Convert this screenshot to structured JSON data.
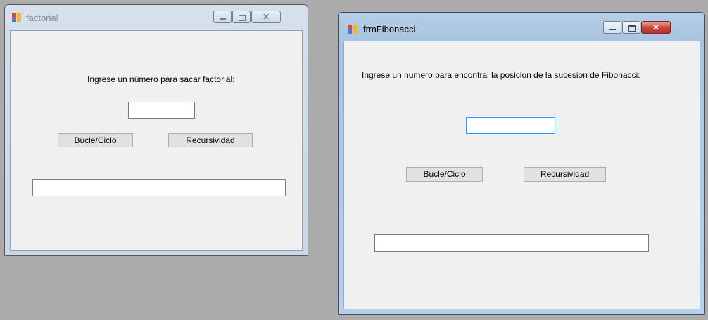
{
  "factorial_window": {
    "title": "factorial",
    "prompt_label": "Ingrese un número para sacar factorial:",
    "input_value": "",
    "loop_button": "Bucle/Ciclo",
    "recursion_button": "Recursividad",
    "result_value": ""
  },
  "fibonacci_window": {
    "title": "frmFibonacci",
    "prompt_label": "Ingrese un numero para encontral la posicion de la sucesion de Fibonacci:",
    "input_value": "",
    "loop_button": "Bucle/Ciclo",
    "recursion_button": "Recursividad",
    "result_value": ""
  },
  "icons": {
    "app": "app-icon",
    "minimize": "minimize-icon",
    "maximize": "maximize-icon",
    "close": "close-icon"
  },
  "colors": {
    "desktop": "#ababab",
    "form_background": "#f0f0f0",
    "close_active": "#c9443b",
    "focus_border": "#3399ff"
  }
}
